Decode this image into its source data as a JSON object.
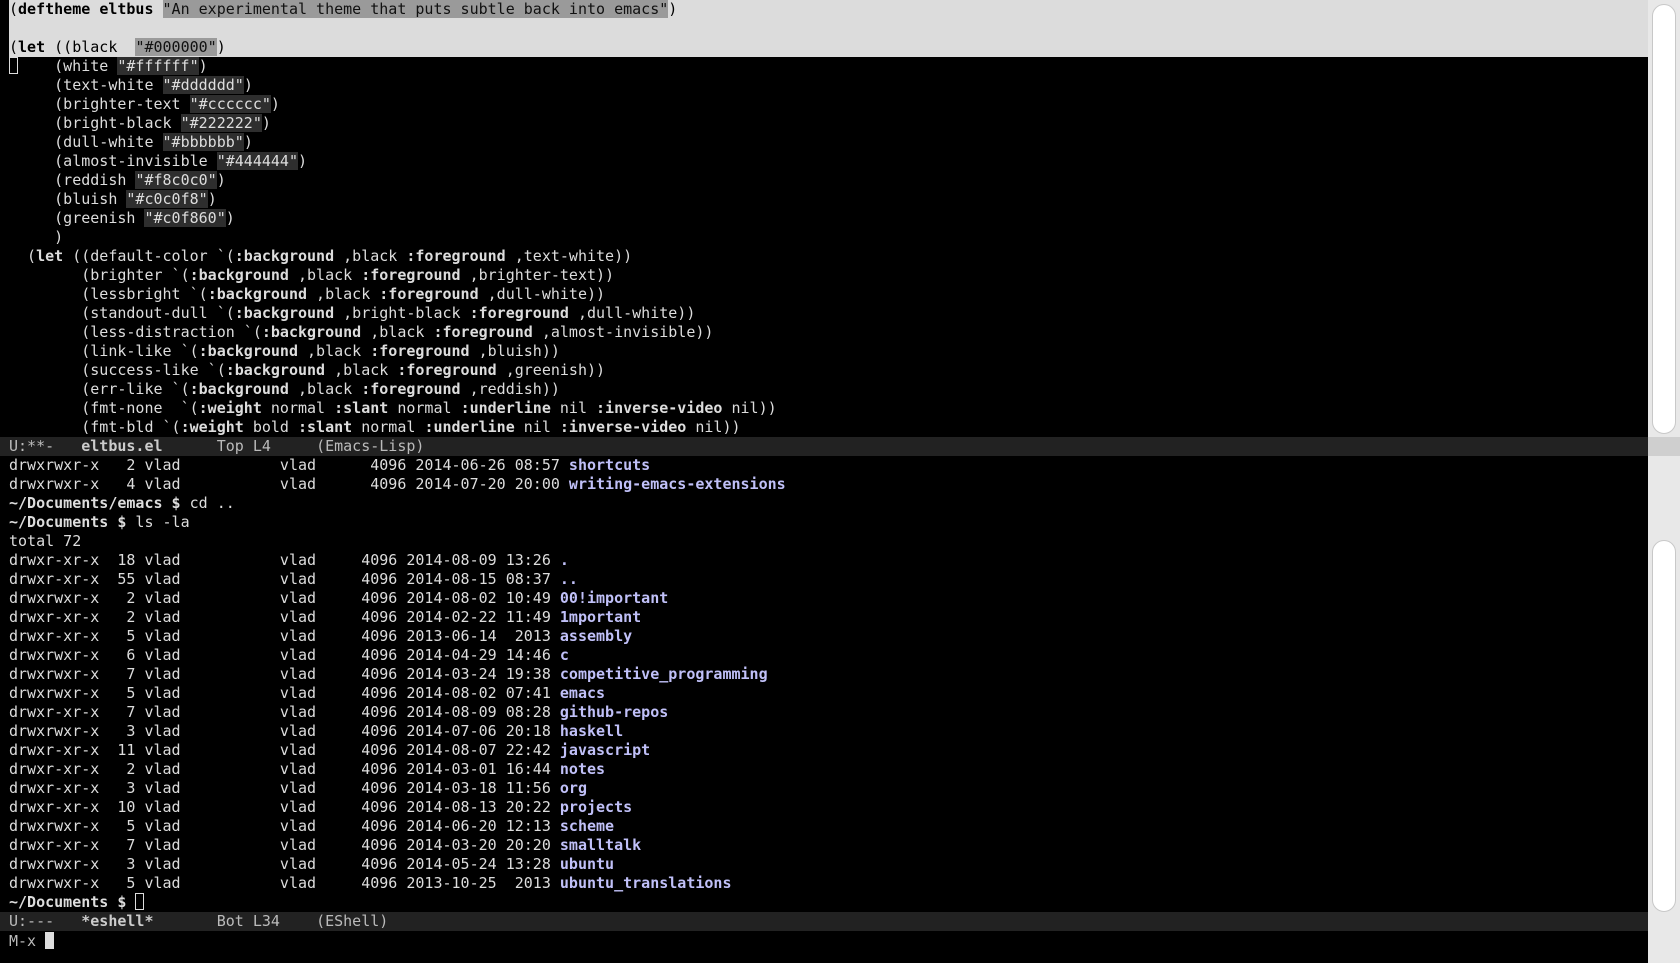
{
  "colors": {
    "background": "#000000",
    "text": "#dddddd",
    "highlight_line": "#dcdcdc",
    "modeline_bg": "#222222",
    "directory": "#c0c0f8",
    "string_bg": "#2e2e2e"
  },
  "editor": {
    "lines": [
      [
        {
          "t": "(",
          "c": ""
        },
        {
          "t": "deftheme",
          "c": "kw"
        },
        {
          "t": " ",
          "c": ""
        },
        {
          "t": "eltbus",
          "c": "kw"
        },
        {
          "t": " ",
          "c": ""
        },
        {
          "t": "\"An experimental theme that puts subtle back into emacs\"",
          "c": "str"
        },
        {
          "t": ")",
          "c": ""
        }
      ],
      [],
      [
        {
          "t": "(",
          "c": ""
        },
        {
          "t": "let",
          "c": "kw"
        },
        {
          "t": " ((black  ",
          "c": ""
        },
        {
          "t": "\"#000000\"",
          "c": "str"
        },
        {
          "t": ")",
          "c": ""
        }
      ],
      [
        {
          "t": "     (white ",
          "c": ""
        },
        {
          "t": "\"#ffffff\"",
          "c": "str"
        },
        {
          "t": ")",
          "c": ""
        }
      ],
      [
        {
          "t": "     (text-white ",
          "c": ""
        },
        {
          "t": "\"#dddddd\"",
          "c": "str"
        },
        {
          "t": ")",
          "c": ""
        }
      ],
      [
        {
          "t": "     (brighter-text ",
          "c": ""
        },
        {
          "t": "\"#cccccc\"",
          "c": "str"
        },
        {
          "t": ")",
          "c": ""
        }
      ],
      [
        {
          "t": "     (bright-black ",
          "c": ""
        },
        {
          "t": "\"#222222\"",
          "c": "str"
        },
        {
          "t": ")",
          "c": ""
        }
      ],
      [
        {
          "t": "     (dull-white ",
          "c": ""
        },
        {
          "t": "\"#bbbbbb\"",
          "c": "str"
        },
        {
          "t": ")",
          "c": ""
        }
      ],
      [
        {
          "t": "     (almost-invisible ",
          "c": ""
        },
        {
          "t": "\"#444444\"",
          "c": "str"
        },
        {
          "t": ")",
          "c": ""
        }
      ],
      [
        {
          "t": "     (reddish ",
          "c": ""
        },
        {
          "t": "\"#f8c0c0\"",
          "c": "str"
        },
        {
          "t": ")",
          "c": ""
        }
      ],
      [
        {
          "t": "     (bluish ",
          "c": ""
        },
        {
          "t": "\"#c0c0f8\"",
          "c": "str"
        },
        {
          "t": ")",
          "c": ""
        }
      ],
      [
        {
          "t": "     (greenish ",
          "c": ""
        },
        {
          "t": "\"#c0f860\"",
          "c": "str"
        },
        {
          "t": ")",
          "c": ""
        }
      ],
      [
        {
          "t": "     )",
          "c": ""
        }
      ],
      [
        {
          "t": "  (",
          "c": ""
        },
        {
          "t": "let",
          "c": "kw"
        },
        {
          "t": " ((default-color `(",
          "c": ""
        },
        {
          "t": ":background",
          "c": "kw"
        },
        {
          "t": " ,black ",
          "c": ""
        },
        {
          "t": ":foreground",
          "c": "kw"
        },
        {
          "t": " ,text-white))",
          "c": ""
        }
      ],
      [
        {
          "t": "        (brighter `(",
          "c": ""
        },
        {
          "t": ":background",
          "c": "kw"
        },
        {
          "t": " ,black ",
          "c": ""
        },
        {
          "t": ":foreground",
          "c": "kw"
        },
        {
          "t": " ,brighter-text))",
          "c": ""
        }
      ],
      [
        {
          "t": "        (lessbright `(",
          "c": ""
        },
        {
          "t": ":background",
          "c": "kw"
        },
        {
          "t": " ,black ",
          "c": ""
        },
        {
          "t": ":foreground",
          "c": "kw"
        },
        {
          "t": " ,dull-white))",
          "c": ""
        }
      ],
      [
        {
          "t": "        (standout-dull `(",
          "c": ""
        },
        {
          "t": ":background",
          "c": "kw"
        },
        {
          "t": " ,bright-black ",
          "c": ""
        },
        {
          "t": ":foreground",
          "c": "kw"
        },
        {
          "t": " ,dull-white))",
          "c": ""
        }
      ],
      [
        {
          "t": "        (less-distraction `(",
          "c": ""
        },
        {
          "t": ":background",
          "c": "kw"
        },
        {
          "t": " ,black ",
          "c": ""
        },
        {
          "t": ":foreground",
          "c": "kw"
        },
        {
          "t": " ,almost-invisible))",
          "c": ""
        }
      ],
      [
        {
          "t": "        (link-like `(",
          "c": ""
        },
        {
          "t": ":background",
          "c": "kw"
        },
        {
          "t": " ,black ",
          "c": ""
        },
        {
          "t": ":foreground",
          "c": "kw"
        },
        {
          "t": " ,bluish))",
          "c": ""
        }
      ],
      [
        {
          "t": "        (success-like `(",
          "c": ""
        },
        {
          "t": ":background",
          "c": "kw"
        },
        {
          "t": " ,black ",
          "c": ""
        },
        {
          "t": ":foreground",
          "c": "kw"
        },
        {
          "t": " ,greenish))",
          "c": ""
        }
      ],
      [
        {
          "t": "        (err-like `(",
          "c": ""
        },
        {
          "t": ":background",
          "c": "kw"
        },
        {
          "t": " ,black ",
          "c": ""
        },
        {
          "t": ":foreground",
          "c": "kw"
        },
        {
          "t": " ,reddish))",
          "c": ""
        }
      ],
      [
        {
          "t": "        (fmt-none  `(",
          "c": ""
        },
        {
          "t": ":weight",
          "c": "kw"
        },
        {
          "t": " normal ",
          "c": ""
        },
        {
          "t": ":slant",
          "c": "kw"
        },
        {
          "t": " normal ",
          "c": ""
        },
        {
          "t": ":underline",
          "c": "kw"
        },
        {
          "t": " nil ",
          "c": ""
        },
        {
          "t": ":inverse-video",
          "c": "kw"
        },
        {
          "t": " nil))",
          "c": ""
        }
      ],
      [
        {
          "t": "        (fmt-bld `(",
          "c": ""
        },
        {
          "t": ":weight",
          "c": "kw"
        },
        {
          "t": " bold ",
          "c": ""
        },
        {
          "t": ":slant",
          "c": "kw"
        },
        {
          "t": " normal ",
          "c": ""
        },
        {
          "t": ":underline",
          "c": "kw"
        },
        {
          "t": " nil ",
          "c": ""
        },
        {
          "t": ":inverse-video",
          "c": "kw"
        },
        {
          "t": " nil))",
          "c": ""
        }
      ]
    ]
  },
  "editor_modeline": {
    "status": "U:**-",
    "buffer": "eltbus.el",
    "position": "Top L4",
    "mode": "(Emacs-Lisp)"
  },
  "shell": {
    "lines": [
      [
        {
          "t": "drwxrwxr-x   2 vlad           vlad      4096 2014-06-26 08:57 ",
          "c": ""
        },
        {
          "t": "shortcuts",
          "c": "dir"
        }
      ],
      [
        {
          "t": "drwxrwxr-x   4 vlad           vlad      4096 2014-07-20 20:00 ",
          "c": ""
        },
        {
          "t": "writing-emacs-extensions",
          "c": "dir"
        }
      ],
      [
        {
          "t": "~/Documents/emacs $",
          "c": "prompt"
        },
        {
          "t": " cd ..",
          "c": ""
        }
      ],
      [
        {
          "t": "~/Documents $",
          "c": "prompt"
        },
        {
          "t": " ls -la",
          "c": ""
        }
      ],
      [
        {
          "t": "total 72",
          "c": ""
        }
      ],
      [
        {
          "t": "drwxr-xr-x  18 vlad           vlad     4096 2014-08-09 13:26 ",
          "c": ""
        },
        {
          "t": ".",
          "c": "dir"
        }
      ],
      [
        {
          "t": "drwxr-xr-x  55 vlad           vlad     4096 2014-08-15 08:37 ",
          "c": ""
        },
        {
          "t": "..",
          "c": "dir"
        }
      ],
      [
        {
          "t": "drwxrwxr-x   2 vlad           vlad     4096 2014-08-02 10:49 ",
          "c": ""
        },
        {
          "t": "00!important",
          "c": "dir"
        }
      ],
      [
        {
          "t": "drwxr-xr-x   2 vlad           vlad     4096 2014-02-22 11:49 ",
          "c": ""
        },
        {
          "t": "1mportant",
          "c": "dir"
        }
      ],
      [
        {
          "t": "drwxr-xr-x   5 vlad           vlad     4096 2013-06-14  2013 ",
          "c": ""
        },
        {
          "t": "assembly",
          "c": "dir"
        }
      ],
      [
        {
          "t": "drwxrwxr-x   6 vlad           vlad     4096 2014-04-29 14:46 ",
          "c": ""
        },
        {
          "t": "c",
          "c": "dir"
        }
      ],
      [
        {
          "t": "drwxrwxr-x   7 vlad           vlad     4096 2014-03-24 19:38 ",
          "c": ""
        },
        {
          "t": "competitive_programming",
          "c": "dir"
        }
      ],
      [
        {
          "t": "drwxrwxr-x   5 vlad           vlad     4096 2014-08-02 07:41 ",
          "c": ""
        },
        {
          "t": "emacs",
          "c": "dir"
        }
      ],
      [
        {
          "t": "drwxr-xr-x   7 vlad           vlad     4096 2014-08-09 08:28 ",
          "c": ""
        },
        {
          "t": "github-repos",
          "c": "dir"
        }
      ],
      [
        {
          "t": "drwxrwxr-x   3 vlad           vlad     4096 2014-07-06 20:18 ",
          "c": ""
        },
        {
          "t": "haskell",
          "c": "dir"
        }
      ],
      [
        {
          "t": "drwxr-xr-x  11 vlad           vlad     4096 2014-08-07 22:42 ",
          "c": ""
        },
        {
          "t": "javascript",
          "c": "dir"
        }
      ],
      [
        {
          "t": "drwxr-xr-x   2 vlad           vlad     4096 2014-03-01 16:44 ",
          "c": ""
        },
        {
          "t": "notes",
          "c": "dir"
        }
      ],
      [
        {
          "t": "drwxr-xr-x   3 vlad           vlad     4096 2014-03-18 11:56 ",
          "c": ""
        },
        {
          "t": "org",
          "c": "dir"
        }
      ],
      [
        {
          "t": "drwxr-xr-x  10 vlad           vlad     4096 2014-08-13 20:22 ",
          "c": ""
        },
        {
          "t": "projects",
          "c": "dir"
        }
      ],
      [
        {
          "t": "drwxrwxr-x   5 vlad           vlad     4096 2014-06-20 12:13 ",
          "c": ""
        },
        {
          "t": "scheme",
          "c": "dir"
        }
      ],
      [
        {
          "t": "drwxr-xr-x   7 vlad           vlad     4096 2014-03-20 20:20 ",
          "c": ""
        },
        {
          "t": "smalltalk",
          "c": "dir"
        }
      ],
      [
        {
          "t": "drwxrwxr-x   3 vlad           vlad     4096 2014-05-24 13:28 ",
          "c": ""
        },
        {
          "t": "ubuntu",
          "c": "dir"
        }
      ],
      [
        {
          "t": "drwxrwxr-x   5 vlad           vlad     4096 2013-10-25  2013 ",
          "c": ""
        },
        {
          "t": "ubuntu_translations",
          "c": "dir"
        }
      ]
    ],
    "prompt": "~/Documents $"
  },
  "shell_modeline": {
    "status": "U:---",
    "buffer": "*eshell*",
    "position": "Bot L34",
    "mode": "(EShell)"
  },
  "minibuffer": {
    "prompt": "M-x"
  }
}
